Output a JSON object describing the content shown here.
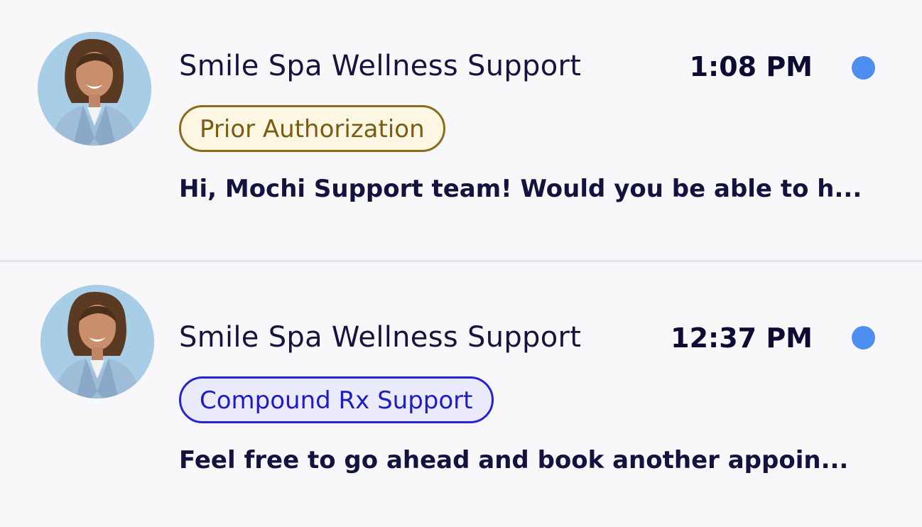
{
  "conversations": [
    {
      "sender": "Smile Spa Wellness Support",
      "time": "1:08 PM",
      "tag": "Prior Authorization",
      "preview": "Hi, Mochi Support team! Would you be able to h...",
      "unread": true,
      "avatar_icon": "user-photo-avatar"
    },
    {
      "sender": "Smile Spa Wellness Support",
      "time": "12:37 PM",
      "tag": "Compound Rx Support",
      "preview": "Feel free to go ahead and book another appoin...",
      "unread": true,
      "avatar_icon": "user-photo-avatar"
    }
  ],
  "colors": {
    "unread_dot": "#4d8ef0",
    "tag_prior_auth_border": "#8b6b1c",
    "tag_compound_border": "#2424d6",
    "avatar_bg": "#a8cde6"
  }
}
